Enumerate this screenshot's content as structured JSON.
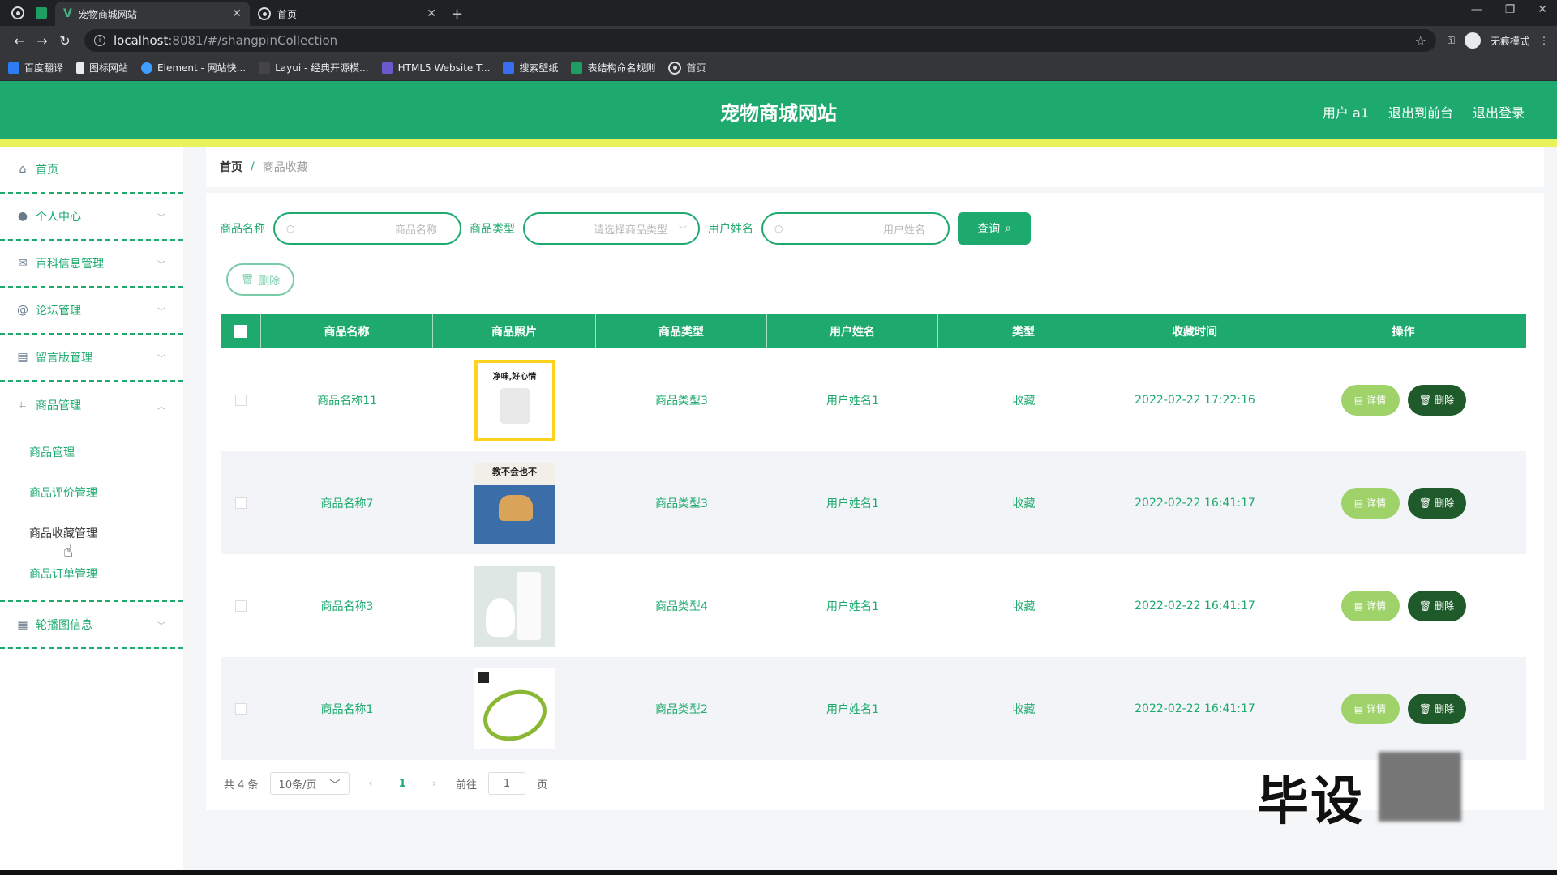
{
  "browser": {
    "tabs": [
      {
        "title": "宠物商城网站",
        "active": true
      },
      {
        "title": "首页",
        "active": false
      }
    ],
    "url_host": "localhost",
    "url_path": ":8081/#/shangpinCollection",
    "incognito_label": "无痕模式",
    "bookmarks": [
      "百度翻译",
      "图标网站",
      "Element - 网站快...",
      "Layui - 经典开源模...",
      "HTML5 Website T...",
      "搜索壁纸",
      "表结构命名规则",
      "首页"
    ]
  },
  "header": {
    "title": "宠物商城网站",
    "links": [
      "用户 a1",
      "退出到前台",
      "退出登录"
    ]
  },
  "sidebar": {
    "items": [
      {
        "label": "首页",
        "icon": "home-icon"
      },
      {
        "label": "个人中心",
        "icon": "user-icon"
      },
      {
        "label": "百科信息管理",
        "icon": "mail-icon"
      },
      {
        "label": "论坛管理",
        "icon": "at-icon"
      },
      {
        "label": "留言版管理",
        "icon": "printer-icon"
      },
      {
        "label": "商品管理",
        "icon": "crop-icon"
      },
      {
        "label": "轮播图信息",
        "icon": "grid-icon"
      }
    ],
    "submenu": [
      "商品管理",
      "商品评价管理",
      "商品收藏管理",
      "商品订单管理"
    ],
    "submenu_active": "商品收藏管理"
  },
  "breadcrumb": {
    "home": "首页",
    "sep": "/",
    "current": "商品收藏"
  },
  "filters": {
    "name_label": "商品名称",
    "name_placeholder": "商品名称",
    "type_label": "商品类型",
    "type_placeholder": "请选择商品类型",
    "user_label": "用户姓名",
    "user_placeholder": "用户姓名",
    "query_label": "查询"
  },
  "bulk_delete_label": "删除",
  "table": {
    "headers": [
      "商品名称",
      "商品照片",
      "商品类型",
      "用户姓名",
      "类型",
      "收藏时间",
      "操作"
    ],
    "rows": [
      {
        "name": "商品名称11",
        "photo_text": "净味,好心情",
        "type": "商品类型3",
        "user": "用户姓名1",
        "kind": "收藏",
        "time": "2022-02-22 17:22:16"
      },
      {
        "name": "商品名称7",
        "photo_text": "教不会也不",
        "type": "商品类型3",
        "user": "用户姓名1",
        "kind": "收藏",
        "time": "2022-02-22 16:41:17"
      },
      {
        "name": "商品名称3",
        "photo_text": "",
        "type": "商品类型4",
        "user": "用户姓名1",
        "kind": "收藏",
        "time": "2022-02-22 16:41:17"
      },
      {
        "name": "商品名称1",
        "photo_text": "",
        "type": "商品类型2",
        "user": "用户姓名1",
        "kind": "收藏",
        "time": "2022-02-22 16:41:17"
      }
    ],
    "detail_label": "详情",
    "delete_label": "删除"
  },
  "pagination": {
    "total": "共 4 条",
    "page_size": "10条/页",
    "current_page": "1",
    "goto_label": "前往",
    "goto_value": "1",
    "page_suffix": "页"
  },
  "watermark": "毕设",
  "colors": {
    "primary": "#1eaa6e",
    "accent_strip": "#e8f25a",
    "detail_btn": "#9fd36a",
    "delete_btn": "#1f5a2a"
  }
}
